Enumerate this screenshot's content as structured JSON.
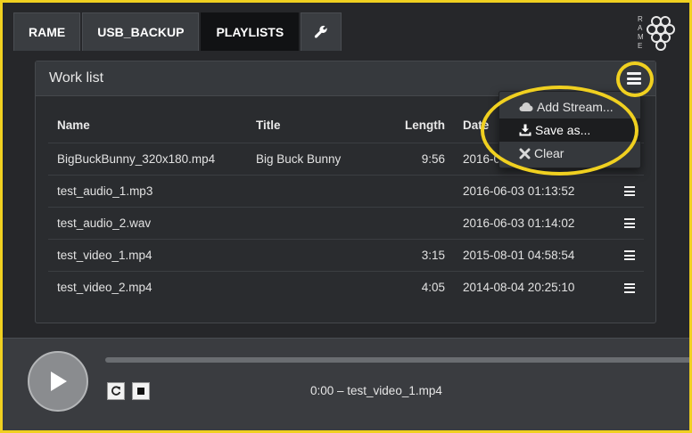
{
  "tabs": [
    {
      "label": "RAME",
      "active": false
    },
    {
      "label": "USB_BACKUP",
      "active": false
    },
    {
      "label": "PLAYLISTS",
      "active": true
    }
  ],
  "tools_icon": "wrench-icon",
  "logo": {
    "text": "RAME",
    "icon": "rame-logo"
  },
  "panel": {
    "title": "Work list",
    "menu_icon": "hamburger-menu-icon"
  },
  "table": {
    "headers": {
      "name": "Name",
      "title": "Title",
      "length": "Length",
      "date": "Date"
    },
    "rows": [
      {
        "name": "BigBuckBunny_320x180.mp4",
        "title": "Big Buck Bunny",
        "length": "9:56",
        "date": "2016-0"
      },
      {
        "name": "test_audio_1.mp3",
        "title": "",
        "length": "",
        "date": "2016-06-03 01:13:52"
      },
      {
        "name": "test_audio_2.wav",
        "title": "",
        "length": "",
        "date": "2016-06-03 01:14:02"
      },
      {
        "name": "test_video_1.mp4",
        "title": "",
        "length": "3:15",
        "date": "2015-08-01 04:58:54"
      },
      {
        "name": "test_video_2.mp4",
        "title": "",
        "length": "4:05",
        "date": "2014-08-04 20:25:10"
      }
    ]
  },
  "dropdown": {
    "items": [
      {
        "label": "Add Stream...",
        "icon": "cloud-icon"
      },
      {
        "label": "Save as...",
        "icon": "download-icon",
        "highlighted": true
      },
      {
        "label": "Clear",
        "icon": "close-icon"
      }
    ]
  },
  "player": {
    "now_playing": "0:00 – test_video_1.mp4",
    "progress_fraction": 0,
    "controls": [
      "play-icon",
      "repeat-icon",
      "stop-icon"
    ]
  },
  "colors": {
    "highlight": "#f0d020",
    "background": "#26272a",
    "panel": "#2a2c2f"
  }
}
